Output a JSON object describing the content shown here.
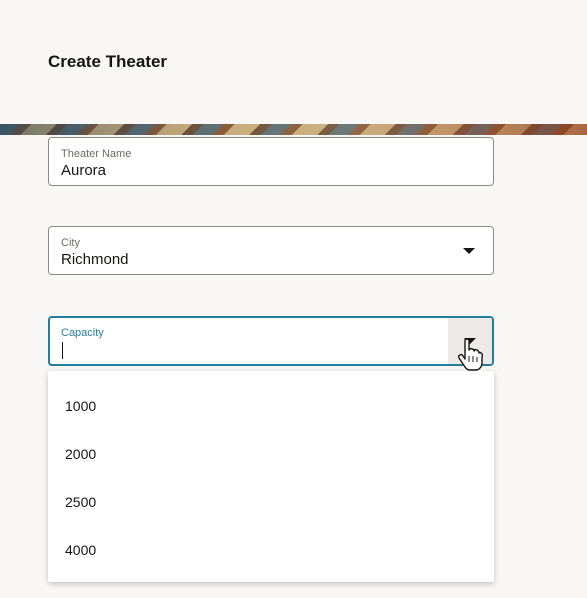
{
  "page": {
    "title": "Create Theater"
  },
  "form": {
    "theater_name": {
      "label": "Theater Name",
      "value": "Aurora"
    },
    "city": {
      "label": "City",
      "value": "Richmond"
    },
    "capacity": {
      "label": "Capacity",
      "value": ""
    }
  },
  "capacity_options": [
    "1000",
    "2000",
    "2500",
    "4000"
  ],
  "colors": {
    "focus_accent": "#227e9e",
    "background": "#f9f7f5"
  },
  "icons": {
    "dropdown": "chevron-down-icon",
    "cursor": "hand-pointer-icon"
  }
}
